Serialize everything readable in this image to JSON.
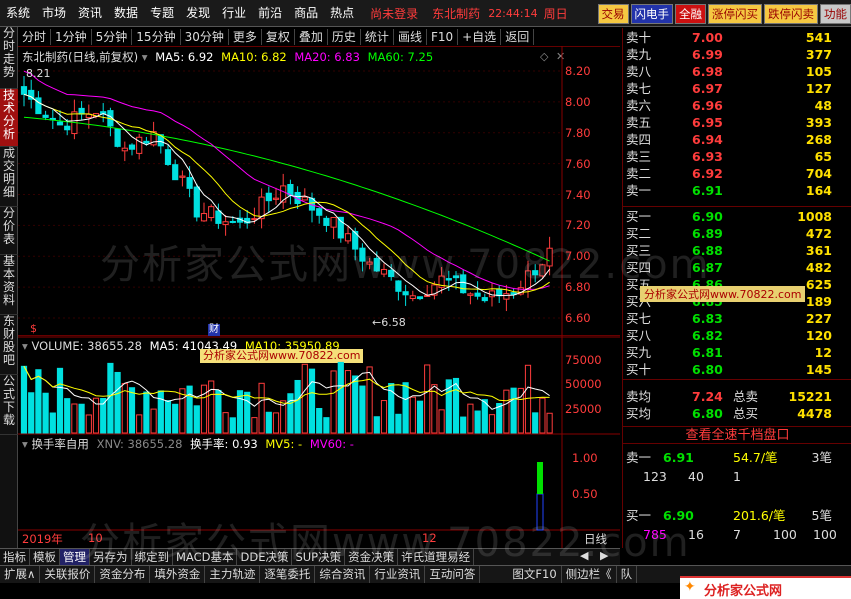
{
  "topbar": {
    "menu": [
      "系统",
      "市场",
      "资讯",
      "数据",
      "专题",
      "发现",
      "行业",
      "前沿",
      "商品",
      "热点"
    ],
    "login": "尚未登录",
    "stock": "东北制药",
    "time": "22:44:14",
    "weekday": "周日",
    "buttons": [
      "交易",
      "闪电手",
      "全融",
      "涨停闪买",
      "跌停闪卖",
      "功能"
    ]
  },
  "leftbar": [
    "分时走势",
    "技术分析",
    "成交明细",
    "分价表",
    "基本资料",
    "东财股吧",
    "公式下载"
  ],
  "toolbar": [
    "分时",
    "1分钟",
    "5分钟",
    "15分钟",
    "30分钟",
    "更多",
    "复权",
    "叠加",
    "历史",
    "统计",
    "画线",
    "F10",
    "+自选",
    "返回"
  ],
  "kline": {
    "title": "东北制药(日线,前复权)",
    "ma5": "MA5: 6.92",
    "ma10": "MA10: 6.82",
    "ma20": "MA20: 6.83",
    "ma60": "MA60: 7.25",
    "high_label": "8.21",
    "low_label": "6.58",
    "marker": "财",
    "marker2": "$"
  },
  "volume": {
    "title": "VOLUME: 38655.28",
    "ma5": "MA5: 41043.49",
    "ma10": "MA10: 35950.89",
    "watermark": "分析家公式网www.70822.com"
  },
  "turnover": {
    "title": "换手率自用",
    "xnv": "XNV: 38655.28",
    "rate": "换手率: 0.93",
    "ma5": "MV5: -",
    "ma60": "MV60: -"
  },
  "price_axis": [
    "8.20",
    "8.00",
    "7.80",
    "7.60",
    "7.40",
    "7.20",
    "7.00",
    "6.80",
    "6.60"
  ],
  "vol_axis": [
    "75000",
    "50000",
    "25000"
  ],
  "to_axis": [
    "1.00",
    "0.50"
  ],
  "date_axis": {
    "year": "2019年",
    "m1": "10",
    "m2": "12",
    "right": "日线"
  },
  "bottom_tabs": [
    "指标",
    "模板",
    "管理",
    "另存为",
    "绑定到",
    "MACD基本",
    "DDE决策",
    "SUP决策",
    "资金决策",
    "许氏道理易经"
  ],
  "status_bar": [
    "扩展∧",
    "关联报价",
    "资金分布",
    "填外资金",
    "主力轨迹",
    "逐笔委托",
    "综合资讯",
    "行业资讯",
    "互动问答",
    "图文F10",
    "侧边栏《",
    "队"
  ],
  "orderbook": {
    "sell": [
      [
        "卖十",
        "7.00",
        "541"
      ],
      [
        "卖九",
        "6.99",
        "377"
      ],
      [
        "卖八",
        "6.98",
        "105"
      ],
      [
        "卖七",
        "6.97",
        "127"
      ],
      [
        "卖六",
        "6.96",
        "48"
      ],
      [
        "卖五",
        "6.95",
        "393"
      ],
      [
        "卖四",
        "6.94",
        "268"
      ],
      [
        "卖三",
        "6.93",
        "65"
      ],
      [
        "卖二",
        "6.92",
        "704"
      ],
      [
        "卖一",
        "6.91",
        "164"
      ]
    ],
    "buy": [
      [
        "买一",
        "6.90",
        "1008"
      ],
      [
        "买二",
        "6.89",
        "472"
      ],
      [
        "买三",
        "6.88",
        "361"
      ],
      [
        "买四",
        "6.87",
        "482"
      ],
      [
        "买五",
        "6.86",
        "625"
      ],
      [
        "买六",
        "6.85",
        "189"
      ],
      [
        "买七",
        "6.83",
        "227"
      ],
      [
        "买八",
        "6.82",
        "120"
      ],
      [
        "买九",
        "6.81",
        "12"
      ],
      [
        "买十",
        "6.80",
        "145"
      ]
    ],
    "avg_sell": {
      "label": "卖均",
      "price": "7.24",
      "tlabel": "总卖",
      "total": "15221"
    },
    "avg_buy": {
      "label": "买均",
      "price": "6.80",
      "tlabel": "总买",
      "total": "4478"
    },
    "query_button": "查看全速千档盘口",
    "sell1": {
      "label": "卖一",
      "price": "6.91",
      "vol": "54.7/笔",
      "count": "3笔",
      "orders": [
        "123",
        "40",
        "1"
      ]
    },
    "buy1": {
      "label": "买一",
      "price": "6.90",
      "vol": "201.6/笔",
      "count": "5笔",
      "orders": [
        "785",
        "16",
        "7",
        "100",
        "100"
      ]
    }
  },
  "watermarks": [
    "分析家公式网www.70822.com",
    "分析家公式网www.70822.com",
    "分析家公式网www.70822.com"
  ],
  "logo": "分析家公式网 www.70822.com",
  "colors": {
    "up": "#ff3c3c",
    "down": "#00e0e0",
    "ma5": "#ffffff",
    "ma10": "#ffff00",
    "ma20": "#ff00ff",
    "ma60": "#00ff00",
    "bg": "#000000"
  }
}
